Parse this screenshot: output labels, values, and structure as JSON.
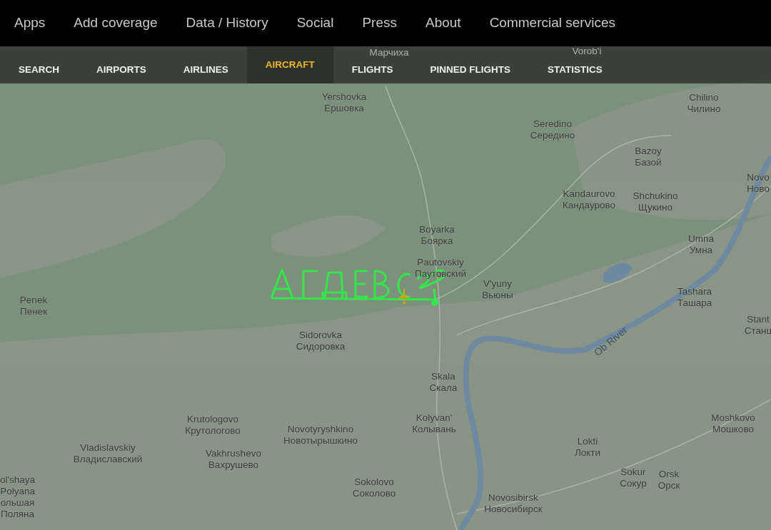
{
  "top_menu": [
    {
      "label": "Apps"
    },
    {
      "label": "Add coverage"
    },
    {
      "label": "Data / History"
    },
    {
      "label": "Social"
    },
    {
      "label": "Press"
    },
    {
      "label": "About"
    },
    {
      "label": "Commercial services"
    }
  ],
  "sub_menu": [
    {
      "label": "SEARCH",
      "selected": false
    },
    {
      "label": "AIRPORTS",
      "selected": false
    },
    {
      "label": "AIRLINES",
      "selected": false
    },
    {
      "label": "AIRCRAFT",
      "selected": true
    },
    {
      "label": "FLIGHTS",
      "selected": false
    },
    {
      "label": "PINNED FLIGHTS",
      "selected": false
    },
    {
      "label": "STATISTICS",
      "selected": false
    }
  ],
  "map": {
    "places": [
      {
        "lines": [
          "Марчиха"
        ]
      },
      {
        "lines": [
          "Vorob'i"
        ]
      },
      {
        "lines": [
          "Yershovka",
          "Ершовка"
        ]
      },
      {
        "lines": [
          "Chilino",
          "Чилино"
        ]
      },
      {
        "lines": [
          "Seredino",
          "Середино"
        ]
      },
      {
        "lines": [
          "Bazoy",
          "Базой"
        ]
      },
      {
        "lines": [
          "Novo",
          "Ново"
        ]
      },
      {
        "lines": [
          "Kandaurovo",
          "Кандаурово"
        ]
      },
      {
        "lines": [
          "Shchukino",
          "Щукино"
        ]
      },
      {
        "lines": [
          "Umna",
          "Умна"
        ]
      },
      {
        "lines": [
          "Boyarka",
          "Боярка"
        ]
      },
      {
        "lines": [
          "Pautovskiy",
          "Паутовский"
        ]
      },
      {
        "lines": [
          "V'yuny",
          "Вьюны"
        ]
      },
      {
        "lines": [
          "Tashara",
          "Ташара"
        ]
      },
      {
        "lines": [
          "Penek",
          "Пенек"
        ]
      },
      {
        "lines": [
          "Stant",
          "Станц"
        ]
      },
      {
        "lines": [
          "Sidorovka",
          "Сидоровка"
        ]
      },
      {
        "lines": [
          "Skala",
          "Скала"
        ]
      },
      {
        "lines": [
          "Krutologovo",
          "Крутологово"
        ]
      },
      {
        "lines": [
          "Kolyvan'",
          "Колывань"
        ]
      },
      {
        "lines": [
          "Moshkovo",
          "Мошково"
        ]
      },
      {
        "lines": [
          "Novotyryshkino",
          "Новотырышкино"
        ]
      },
      {
        "lines": [
          "Vladislavskiy",
          "Владиславский"
        ]
      },
      {
        "lines": [
          "Lokti",
          "Локти"
        ]
      },
      {
        "lines": [
          "Vakhrushevo",
          "Вахрушево"
        ]
      },
      {
        "lines": [
          "Sokur",
          "Сокур"
        ]
      },
      {
        "lines": [
          "Orsk",
          "Орск"
        ]
      },
      {
        "lines": [
          "ol'shaya",
          "Polyana",
          "ольшая",
          "Поляна"
        ]
      },
      {
        "lines": [
          "Sokolovo",
          "Соколово"
        ]
      },
      {
        "lines": [
          "Novosibirsk",
          "Новосибирск"
        ]
      }
    ],
    "river_label": "Ob River"
  }
}
